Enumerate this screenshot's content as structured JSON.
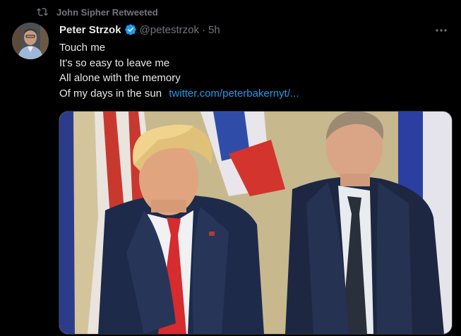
{
  "retweet": {
    "label": "John Sipher Retweeted",
    "icon": "retweet-icon"
  },
  "author": {
    "name": "Peter Strzok",
    "handle": "@petestrzok",
    "separator": "·",
    "time": "5h",
    "verified": true,
    "verified_color": "#1d9bf0"
  },
  "tweet": {
    "lines": [
      "Touch me",
      "It's so easy to leave me",
      "All alone with the memory",
      "Of my days in the sun"
    ],
    "link_text": "twitter.com/peterbakernyt/...",
    "link_color": "#1d9bf0"
  },
  "media": {
    "icon": "photo-two-men-in-suits"
  },
  "colors": {
    "background": "#000000",
    "text": "#e7e9ea",
    "secondary": "#71767b"
  }
}
